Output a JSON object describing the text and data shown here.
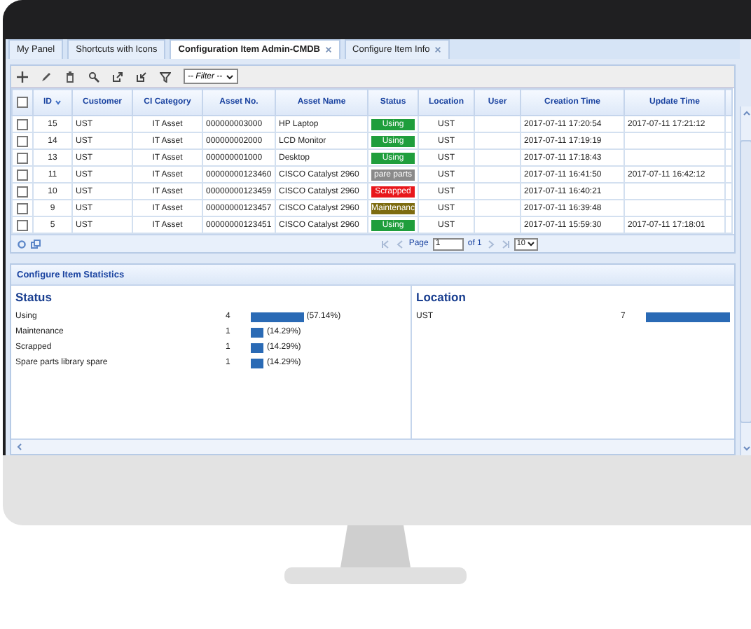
{
  "tabs": [
    {
      "label": "My Panel",
      "selected": false,
      "closable": false
    },
    {
      "label": "Shortcuts with Icons",
      "selected": false,
      "closable": false
    },
    {
      "label": "Configuration Item Admin-CMDB",
      "selected": true,
      "closable": true
    },
    {
      "label": "Configure Item Info",
      "selected": false,
      "closable": true
    }
  ],
  "toolbar": {
    "filter": "-- Filter --"
  },
  "table": {
    "header_checked": false,
    "columns": [
      {
        "label": "ID",
        "sorted_descending": true
      },
      {
        "label": "Customer"
      },
      {
        "label": "CI Category"
      },
      {
        "label": "Asset No."
      },
      {
        "label": "Asset Name"
      },
      {
        "label": "Status"
      },
      {
        "label": "Location"
      },
      {
        "label": "User"
      },
      {
        "label": "Creation Time"
      },
      {
        "label": "Update Time"
      }
    ],
    "rows": [
      {
        "checked": false,
        "id": "15",
        "customer": "UST",
        "category": "IT Asset",
        "asset_no": "000000003000",
        "asset_name": "HP Laptop",
        "status": {
          "label": "Using",
          "color": "#1f9e3c"
        },
        "location": "UST",
        "created": "2017-07-11 17:20:54",
        "updated": "2017-07-11 17:21:12"
      },
      {
        "checked": false,
        "id": "14",
        "customer": "UST",
        "category": "IT Asset",
        "asset_no": "000000002000",
        "asset_name": "LCD Monitor",
        "status": {
          "label": "Using",
          "color": "#1f9e3c"
        },
        "location": "UST",
        "created": "2017-07-11 17:19:19"
      },
      {
        "checked": false,
        "id": "13",
        "customer": "UST",
        "category": "IT Asset",
        "asset_no": "000000001000",
        "asset_name": "Desktop",
        "status": {
          "label": "Using",
          "color": "#1f9e3c"
        },
        "location": "UST",
        "created": "2017-07-11 17:18:43"
      },
      {
        "checked": false,
        "id": "11",
        "customer": "UST",
        "category": "IT Asset",
        "asset_no": "00000000123460",
        "asset_name": "CISCO Catalyst 2960",
        "status": {
          "label": "pare parts",
          "color": "#8a8a8a"
        },
        "location": "UST",
        "created": "2017-07-11 16:41:50",
        "updated": "2017-07-11 16:42:12"
      },
      {
        "checked": false,
        "id": "10",
        "customer": "UST",
        "category": "IT Asset",
        "asset_no": "00000000123459",
        "asset_name": "CISCO Catalyst 2960",
        "status": {
          "label": "Scrapped",
          "color": "#e8161b"
        },
        "location": "UST",
        "created": "2017-07-11 16:40:21"
      },
      {
        "checked": false,
        "id": "9",
        "customer": "UST",
        "category": "IT Asset",
        "asset_no": "00000000123457",
        "asset_name": "CISCO Catalyst 2960",
        "status": {
          "label": "Maintenanc",
          "color": "#7d6b10"
        },
        "location": "UST",
        "created": "2017-07-11 16:39:48"
      },
      {
        "checked": false,
        "id": "5",
        "customer": "UST",
        "category": "IT Asset",
        "asset_no": "00000000123451",
        "asset_name": "CISCO Catalyst 2960",
        "status": {
          "label": "Using",
          "color": "#1f9e3c"
        },
        "location": "UST",
        "created": "2017-07-11 15:59:30",
        "updated": "2017-07-11 17:18:01"
      }
    ]
  },
  "pager": {
    "label": "Page",
    "page": "1",
    "of": "of 1",
    "page_size": "10"
  },
  "stats": {
    "title": "Configure Item Statistics",
    "panels": [
      {
        "title": "Status",
        "rows": [
          {
            "label": "Using",
            "count": "4",
            "percent": "(57.14%)"
          },
          {
            "label": "Maintenance",
            "count": "1",
            "percent": "(14.29%)"
          },
          {
            "label": "Scrapped",
            "count": "1",
            "percent": "(14.29%)"
          },
          {
            "label": "Spare parts library spare",
            "count": "1",
            "percent": "(14.29%)"
          }
        ]
      },
      {
        "title": "Location",
        "rows": [
          {
            "label": "UST",
            "count": "7"
          }
        ]
      }
    ]
  }
}
